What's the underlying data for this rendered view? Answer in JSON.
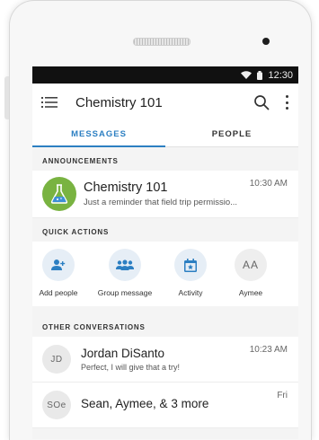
{
  "status_bar": {
    "time": "12:30"
  },
  "app_bar": {
    "title": "Chemistry 101"
  },
  "tabs": [
    {
      "label": "MESSAGES",
      "active": true
    },
    {
      "label": "PEOPLE",
      "active": false
    }
  ],
  "announcements": {
    "header": "ANNOUNCEMENTS",
    "items": [
      {
        "title": "Chemistry 101",
        "time": "10:30 AM",
        "preview": "Just a reminder that field trip permissio..."
      }
    ]
  },
  "quick_actions": {
    "header": "QUICK ACTIONS",
    "items": [
      {
        "label": "Add people",
        "icon": "add-person-icon"
      },
      {
        "label": "Group message",
        "icon": "group-icon"
      },
      {
        "label": "Activity",
        "icon": "calendar-star-icon"
      },
      {
        "label": "Aymee",
        "initials": "AA"
      }
    ]
  },
  "conversations": {
    "header": "OTHER CONVERSATIONS",
    "items": [
      {
        "initials": "JD",
        "name": "Jordan DiSanto",
        "time": "10:23 AM",
        "preview": "Perfect, I will give that a try!"
      },
      {
        "initials": "SOe",
        "name": "Sean, Aymee, & 3 more",
        "time": "Fri",
        "preview": ""
      }
    ]
  },
  "colors": {
    "accent": "#2c7fc2",
    "flask_avatar": "#79b341",
    "status_bar": "#111111"
  }
}
